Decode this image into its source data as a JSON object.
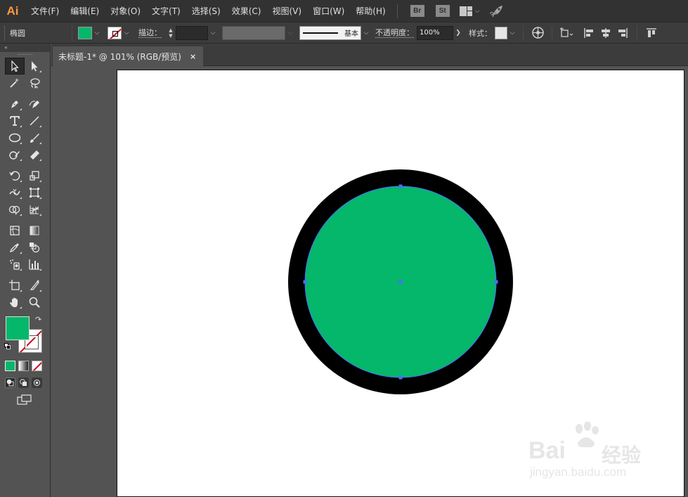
{
  "app": {
    "logo": "Ai",
    "accent": "#ff9a3c"
  },
  "menu": [
    "文件(F)",
    "编辑(E)",
    "对象(O)",
    "文字(T)",
    "选择(S)",
    "效果(C)",
    "视图(V)",
    "窗口(W)",
    "帮助(H)"
  ],
  "menu_apps": {
    "bridge": "Br",
    "stock": "St"
  },
  "control": {
    "object_type": "椭圆",
    "fill_color": "#05b76a",
    "stroke_label": "描边：",
    "stroke_profile": "基本",
    "opacity_label": "不透明度：",
    "opacity_value": "100%",
    "style_label": "样式："
  },
  "document": {
    "tab_title": "未标题-1* @ 101% (RGB/预览)",
    "close_glyph": "×"
  },
  "tools": {
    "fill_color": "#05b76a",
    "stroke_color": "none"
  },
  "artwork": {
    "shape": "ellipse",
    "fill": "#05b76a",
    "stroke": "#000000",
    "selection_color": "#4f6cff"
  },
  "watermark": {
    "brand": "Bai",
    "brand2": "经验",
    "sub": "jingyan.baidu.com"
  }
}
